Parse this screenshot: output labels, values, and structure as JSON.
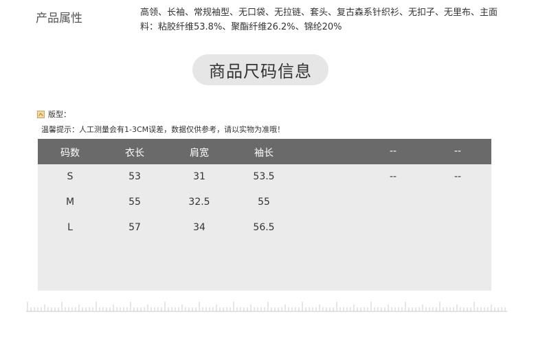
{
  "attributes": {
    "label": "产品属性",
    "value": "高领、长袖、常规袖型、无口袋、无拉链、套头、复古森系针织衫、无扣子、无里布、主面料：粘胶纤维53.8%、聚酯纤维26.2%、锦纶20%"
  },
  "section_title": "商品尺码信息",
  "fit": {
    "icon": "fit-type-icon",
    "label": "版型："
  },
  "hint": "温馨提示：人工测量会有1-3CM误差，数据仅供参考，请以实物为准哦！",
  "size_table": {
    "headers": [
      "码数",
      "衣长",
      "肩宽",
      "袖长",
      "--",
      "--"
    ],
    "rows": [
      [
        "S",
        "53",
        "31",
        "53.5",
        "--",
        "--"
      ],
      [
        "M",
        "55",
        "32.5",
        "55",
        "",
        ""
      ],
      [
        "L",
        "57",
        "34",
        "56.5",
        "",
        ""
      ]
    ]
  },
  "colors": {
    "header_bg": "#6a6a6a",
    "table_bg": "#ebebeb",
    "pill_bg": "#e6e6e6"
  }
}
